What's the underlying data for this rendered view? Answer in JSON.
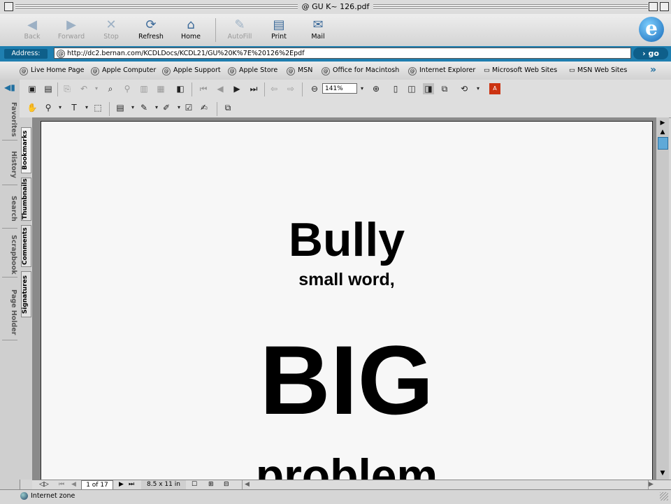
{
  "window": {
    "title": "GU K~ 126.pdf"
  },
  "toolbar": {
    "back": "Back",
    "forward": "Forward",
    "stop": "Stop",
    "refresh": "Refresh",
    "home": "Home",
    "autofill": "AutoFill",
    "print": "Print",
    "mail": "Mail"
  },
  "address": {
    "label": "Address:",
    "url": "http://dc2.bernan.com/KCDLDocs/KCDL21/GU%20K%7E%20126%2Epdf",
    "go": "go"
  },
  "favorites": [
    "Live Home Page",
    "Apple Computer",
    "Apple Support",
    "Apple Store",
    "MSN",
    "Office for Macintosh",
    "Internet Explorer",
    "Microsoft Web Sites",
    "MSN Web Sites"
  ],
  "explorer_tabs": [
    "Favorites",
    "History",
    "Search",
    "Scrapbook",
    "Page Holder"
  ],
  "acrobat": {
    "zoom": "141%",
    "nav_tabs": [
      "Bookmarks",
      "Thumbnails",
      "Comments",
      "Signatures"
    ]
  },
  "document": {
    "line1": "Bully",
    "line2": "small word,",
    "line3": "BIG",
    "line4": "problem"
  },
  "pagenav": {
    "page": "1 of 17",
    "size": "8.5 x 11 in"
  },
  "status": {
    "zone": "Internet zone"
  },
  "colors": {
    "accent": "#1f7fb0",
    "page": "#f7f7f7"
  }
}
